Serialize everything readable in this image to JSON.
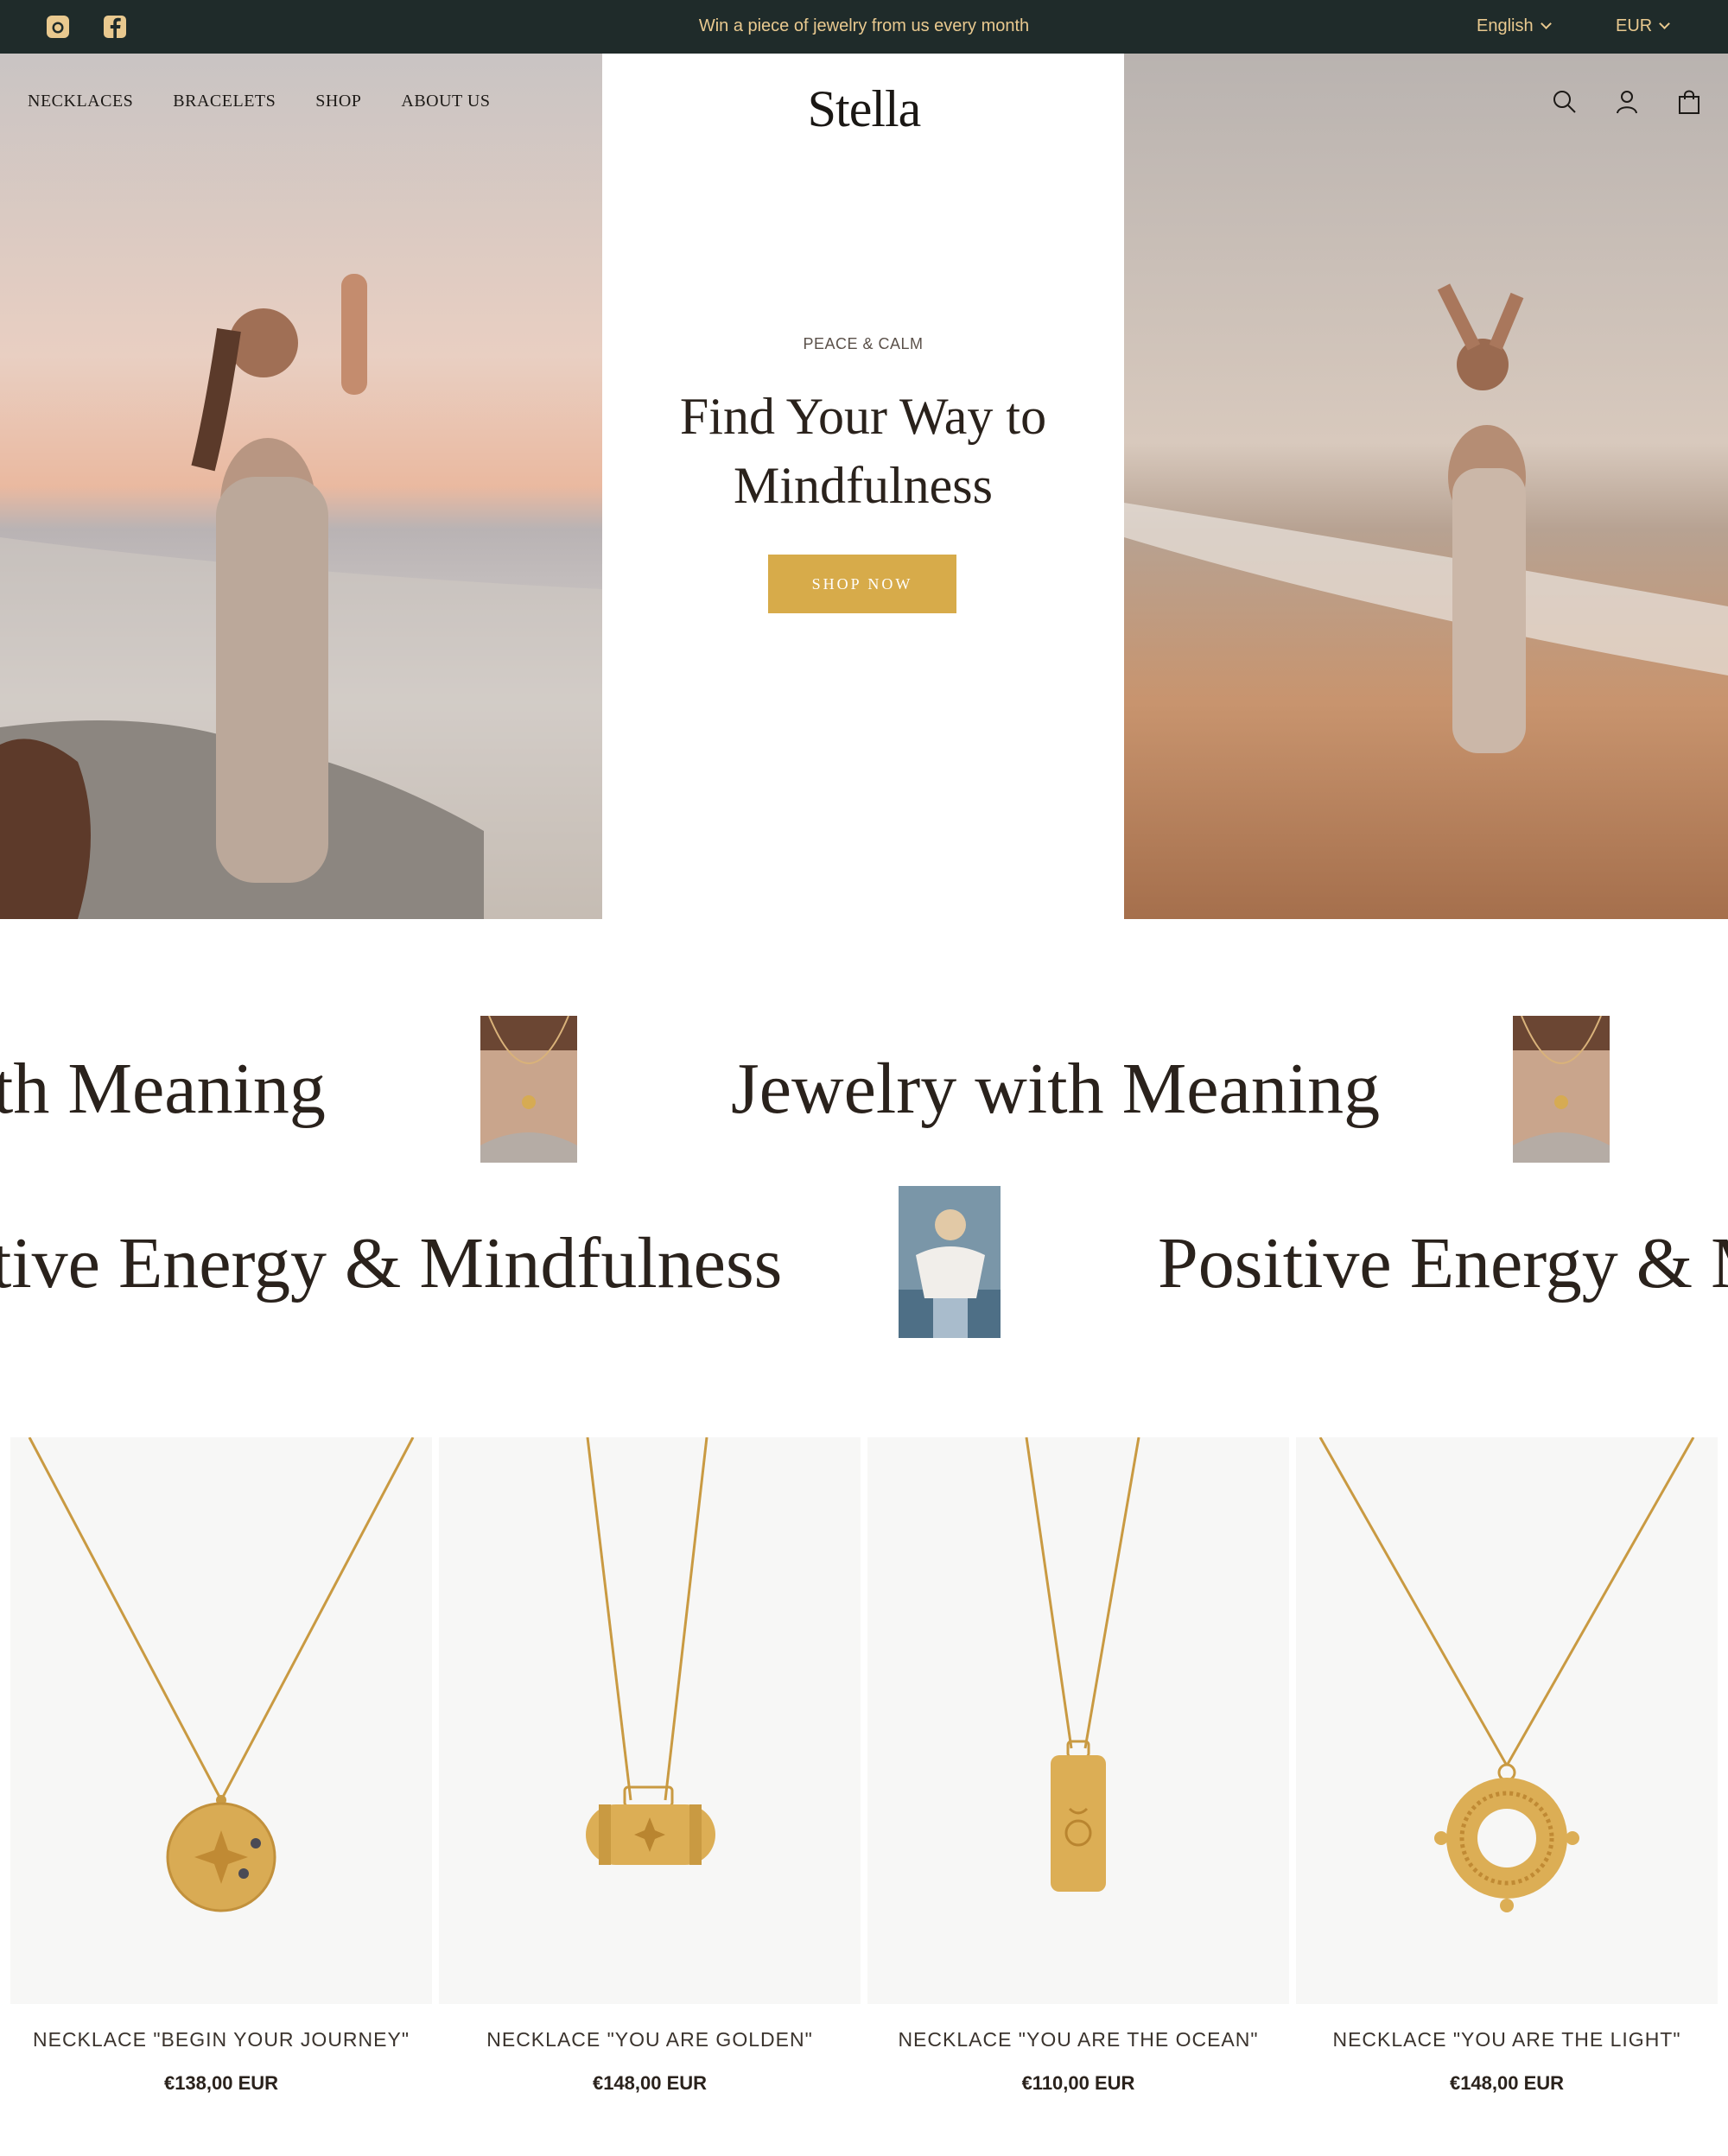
{
  "topbar": {
    "announcement": "Win a piece of jewelry from us every month",
    "language": "English",
    "currency": "EUR",
    "socials": [
      "instagram-icon",
      "facebook-icon"
    ]
  },
  "header": {
    "logo": "Stella",
    "nav": [
      "NECKLACES",
      "BRACELETS",
      "SHOP",
      "ABOUT US"
    ],
    "icons": [
      "search-icon",
      "account-icon",
      "cart-icon"
    ]
  },
  "hero": {
    "eyebrow": "PEACE & CALM",
    "headline_line1": "Find Your Way to",
    "headline_line2": "Mindfulness",
    "cta": "SHOP NOW"
  },
  "marquee": {
    "row1_partial": "th Meaning",
    "row1_full": "Jewelry with Meaning",
    "row2_partial": "tive Energy & Mindfulness",
    "row2_full": "Positive Energy & M"
  },
  "products": [
    {
      "name": "NECKLACE \"BEGIN YOUR JOURNEY\"",
      "price": "€138,00 EUR"
    },
    {
      "name": "NECKLACE \"YOU ARE GOLDEN\"",
      "price": "€148,00 EUR"
    },
    {
      "name": "NECKLACE \"YOU ARE THE OCEAN\"",
      "price": "€110,00 EUR"
    },
    {
      "name": "NECKLACE \"YOU ARE THE LIGHT\"",
      "price": "€148,00 EUR"
    }
  ],
  "colors": {
    "topbar_bg": "#1f2b2a",
    "topbar_text": "#e9c98f",
    "accent": "#d7ab4a",
    "text": "#2a221c"
  }
}
